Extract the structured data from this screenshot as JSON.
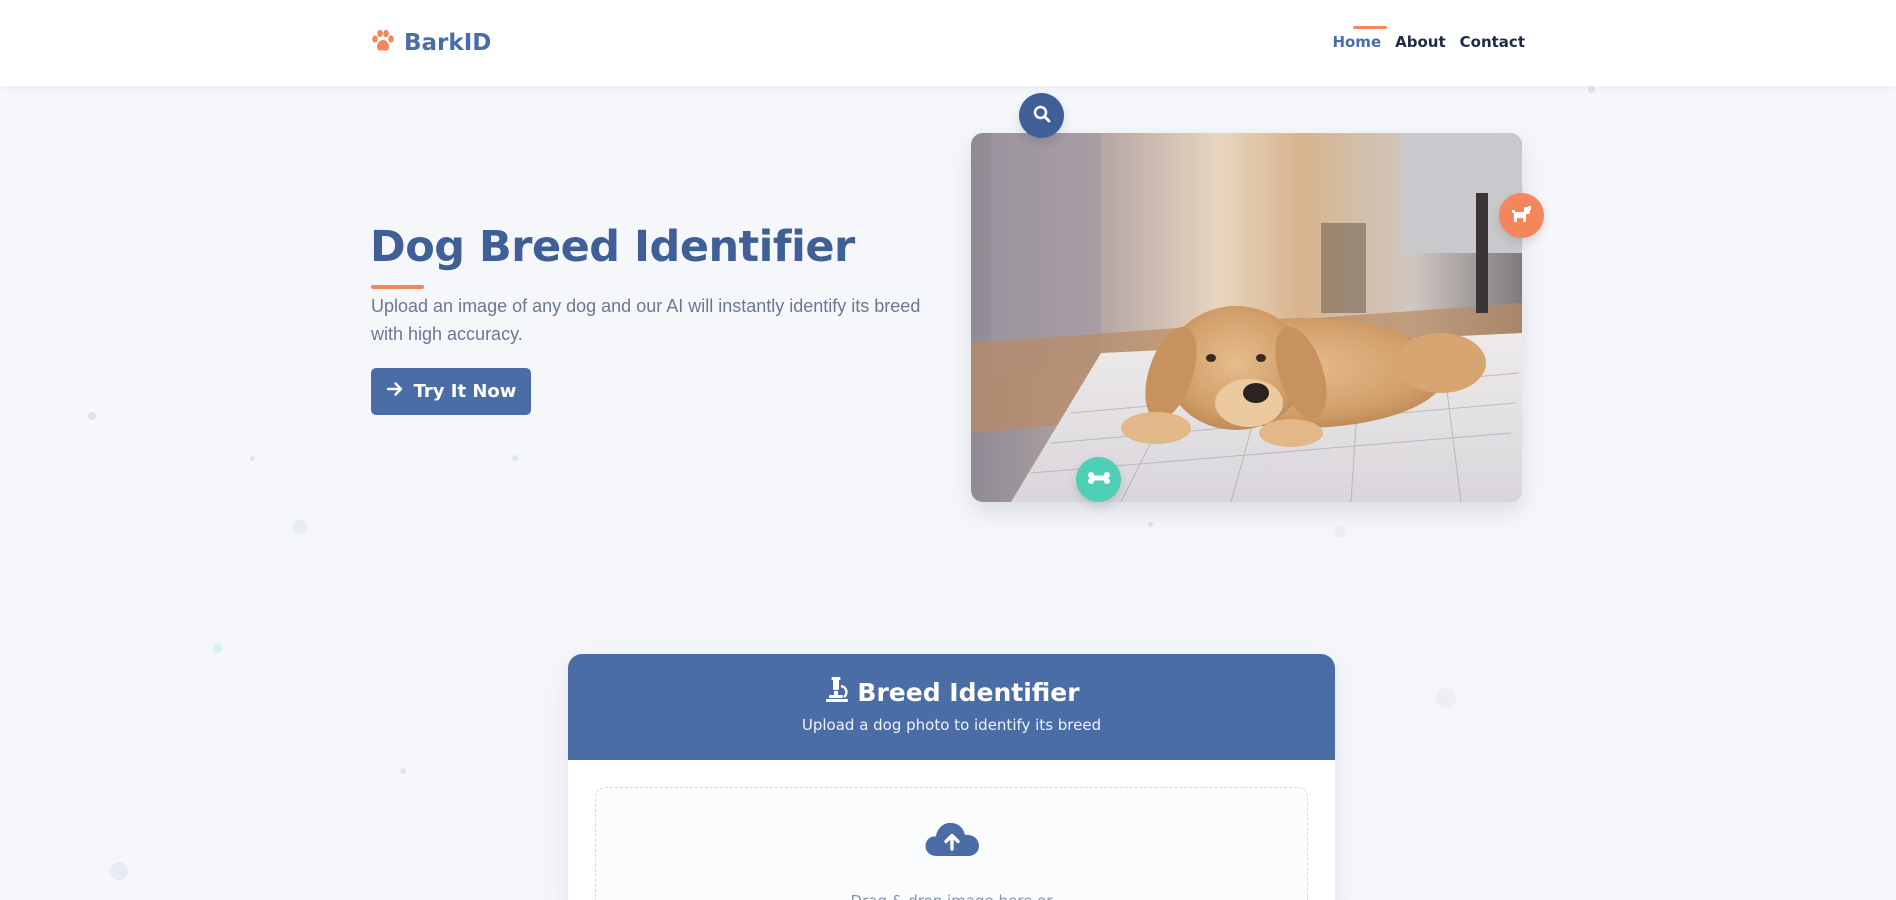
{
  "header": {
    "logo_text": "BarkID",
    "nav": [
      {
        "label": "Home",
        "active": true
      },
      {
        "label": "About",
        "active": false
      },
      {
        "label": "Contact",
        "active": false
      }
    ]
  },
  "hero": {
    "title": "Dog Breed Identifier",
    "subtitle": "Upload an image of any dog and our AI will instantly identify its breed with high accuracy.",
    "cta_label": "Try It Now"
  },
  "identifier_card": {
    "title": "Breed Identifier",
    "subtitle": "Upload a dog photo to identify its breed",
    "dropzone_text": "Drag & drop image here or"
  },
  "colors": {
    "brand_blue": "#4a6da6",
    "accent_orange": "#f5855c",
    "accent_teal": "#4fcfb5",
    "background": "#f6f7fa"
  },
  "icons": [
    "paw-icon",
    "arrow-right-icon",
    "search-icon",
    "dog-icon",
    "bone-icon",
    "microscope-icon",
    "cloud-upload-icon"
  ]
}
